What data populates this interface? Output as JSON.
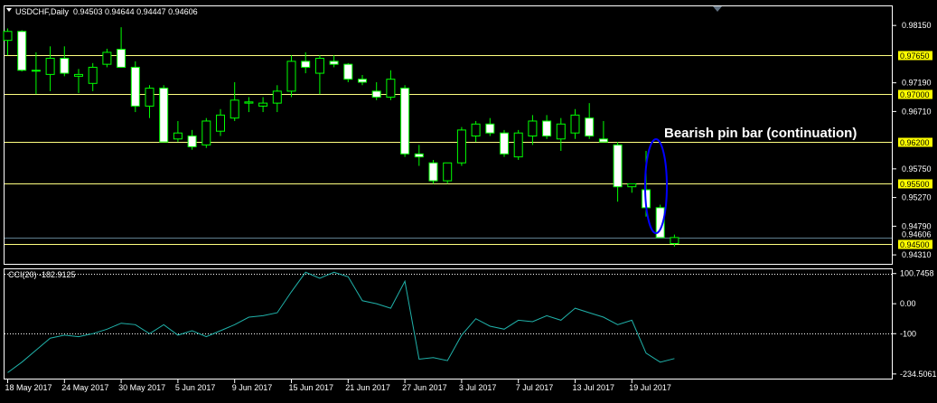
{
  "header": {
    "symbol_line": "USDCHF,Daily  0.94503 0.94644 0.94447 0.94606",
    "indicator_label": "CCI(20) -182.9125"
  },
  "annotation": {
    "text": "Bearish pin bar (continuation)"
  },
  "colors": {
    "background": "#000000",
    "bull_body": "#000000",
    "bull_edge": "#00ff00",
    "bear_body": "#ffffff",
    "wick": "#00ff00",
    "level_line": "#ffff80",
    "cci_line": "#20b2aa",
    "grid_axis": "#ffffff",
    "price_tag_bg": "#ffff00",
    "annotation_ellipse": "#0000ff"
  },
  "chart_data": [
    {
      "type": "candlestick",
      "title": "USDCHF,Daily",
      "ylim": [
        0.9416,
        0.9847
      ],
      "y_ticks": [
        "0.98150",
        "0.97190",
        "0.96710",
        "0.95750",
        "0.95270",
        "0.94790",
        "0.94310"
      ],
      "level_lines": [
        "0.97650",
        "0.97000",
        "0.96200",
        "0.95500",
        "0.94500"
      ],
      "current_price_label": "0.94606",
      "x_labels": [
        "18 May 2017",
        "24 May 2017",
        "30 May 2017",
        "5 Jun 2017",
        "9 Jun 2017",
        "15 Jun 2017",
        "21 Jun 2017",
        "27 Jun 2017",
        "3 Jul 2017",
        "7 Jul 2017",
        "13 Jul 2017",
        "19 Jul 2017"
      ],
      "x_label_index": [
        0,
        4,
        8,
        12,
        16,
        20,
        24,
        28,
        32,
        36,
        40,
        44
      ],
      "candles": [
        {
          "o": 0.979,
          "h": 0.981,
          "l": 0.9765,
          "c": 0.9805
        },
        {
          "o": 0.9805,
          "h": 0.9807,
          "l": 0.9738,
          "c": 0.974
        },
        {
          "o": 0.974,
          "h": 0.977,
          "l": 0.97,
          "c": 0.974
        },
        {
          "o": 0.9733,
          "h": 0.978,
          "l": 0.9705,
          "c": 0.976
        },
        {
          "o": 0.976,
          "h": 0.978,
          "l": 0.973,
          "c": 0.9735
        },
        {
          "o": 0.973,
          "h": 0.9742,
          "l": 0.9702,
          "c": 0.9733
        },
        {
          "o": 0.9718,
          "h": 0.9752,
          "l": 0.9705,
          "c": 0.9745
        },
        {
          "o": 0.975,
          "h": 0.9776,
          "l": 0.9745,
          "c": 0.977
        },
        {
          "o": 0.9775,
          "h": 0.9812,
          "l": 0.9745,
          "c": 0.9745
        },
        {
          "o": 0.9745,
          "h": 0.9755,
          "l": 0.967,
          "c": 0.968
        },
        {
          "o": 0.968,
          "h": 0.9715,
          "l": 0.966,
          "c": 0.971
        },
        {
          "o": 0.971,
          "h": 0.9715,
          "l": 0.962,
          "c": 0.962
        },
        {
          "o": 0.9625,
          "h": 0.9655,
          "l": 0.962,
          "c": 0.9635
        },
        {
          "o": 0.963,
          "h": 0.964,
          "l": 0.9607,
          "c": 0.9612
        },
        {
          "o": 0.9615,
          "h": 0.966,
          "l": 0.961,
          "c": 0.9655
        },
        {
          "o": 0.9638,
          "h": 0.9675,
          "l": 0.963,
          "c": 0.9665
        },
        {
          "o": 0.966,
          "h": 0.972,
          "l": 0.9655,
          "c": 0.969
        },
        {
          "o": 0.9685,
          "h": 0.9695,
          "l": 0.967,
          "c": 0.9687
        },
        {
          "o": 0.968,
          "h": 0.9695,
          "l": 0.967,
          "c": 0.9685
        },
        {
          "o": 0.9685,
          "h": 0.9715,
          "l": 0.967,
          "c": 0.9705
        },
        {
          "o": 0.9705,
          "h": 0.9765,
          "l": 0.9695,
          "c": 0.9755
        },
        {
          "o": 0.9755,
          "h": 0.977,
          "l": 0.9735,
          "c": 0.9745
        },
        {
          "o": 0.9735,
          "h": 0.9765,
          "l": 0.97,
          "c": 0.976
        },
        {
          "o": 0.9755,
          "h": 0.9765,
          "l": 0.9745,
          "c": 0.975
        },
        {
          "o": 0.975,
          "h": 0.9752,
          "l": 0.972,
          "c": 0.9725
        },
        {
          "o": 0.9725,
          "h": 0.9732,
          "l": 0.9715,
          "c": 0.972
        },
        {
          "o": 0.9705,
          "h": 0.972,
          "l": 0.969,
          "c": 0.9695
        },
        {
          "o": 0.9695,
          "h": 0.974,
          "l": 0.969,
          "c": 0.9725
        },
        {
          "o": 0.971,
          "h": 0.9715,
          "l": 0.9595,
          "c": 0.96
        },
        {
          "o": 0.96,
          "h": 0.9615,
          "l": 0.958,
          "c": 0.9595
        },
        {
          "o": 0.9585,
          "h": 0.959,
          "l": 0.955,
          "c": 0.9555
        },
        {
          "o": 0.9555,
          "h": 0.9585,
          "l": 0.955,
          "c": 0.9585
        },
        {
          "o": 0.9585,
          "h": 0.9645,
          "l": 0.958,
          "c": 0.964
        },
        {
          "o": 0.963,
          "h": 0.9655,
          "l": 0.962,
          "c": 0.965
        },
        {
          "o": 0.965,
          "h": 0.966,
          "l": 0.963,
          "c": 0.9635
        },
        {
          "o": 0.9635,
          "h": 0.964,
          "l": 0.9595,
          "c": 0.96
        },
        {
          "o": 0.9595,
          "h": 0.964,
          "l": 0.959,
          "c": 0.9635
        },
        {
          "o": 0.963,
          "h": 0.9665,
          "l": 0.9615,
          "c": 0.9655
        },
        {
          "o": 0.9655,
          "h": 0.9665,
          "l": 0.9625,
          "c": 0.963
        },
        {
          "o": 0.9625,
          "h": 0.966,
          "l": 0.9605,
          "c": 0.965
        },
        {
          "o": 0.9635,
          "h": 0.9675,
          "l": 0.9625,
          "c": 0.9665
        },
        {
          "o": 0.966,
          "h": 0.9685,
          "l": 0.9625,
          "c": 0.963
        },
        {
          "o": 0.9625,
          "h": 0.9655,
          "l": 0.962,
          "c": 0.962
        },
        {
          "o": 0.9615,
          "h": 0.962,
          "l": 0.952,
          "c": 0.9545
        },
        {
          "o": 0.9545,
          "h": 0.955,
          "l": 0.9535,
          "c": 0.955
        },
        {
          "o": 0.954,
          "h": 0.9605,
          "l": 0.9495,
          "c": 0.951
        },
        {
          "o": 0.951,
          "h": 0.9515,
          "l": 0.946,
          "c": 0.946
        },
        {
          "o": 0.945,
          "h": 0.9465,
          "l": 0.9445,
          "c": 0.946
        }
      ],
      "pin_bar_index": 45
    },
    {
      "type": "line",
      "title": "CCI(20) -182.9125",
      "ylim": [
        -250,
        115
      ],
      "y_ticks": [
        "100.7458",
        "0.00",
        "-100",
        "-234.5061"
      ],
      "y_tick_values": [
        100.7458,
        0,
        -100,
        -234.5061
      ],
      "dotted_levels": [
        100,
        -100
      ],
      "series": [
        {
          "values": [
            -230,
            -195,
            -155,
            -115,
            -105,
            -110,
            -100,
            -85,
            -65,
            -70,
            -100,
            -70,
            -105,
            -90,
            -110,
            -90,
            -70,
            -45,
            -40,
            -30,
            40,
            105,
            85,
            105,
            90,
            10,
            0,
            -15,
            75,
            -185,
            -180,
            -190,
            -105,
            -50,
            -75,
            -85,
            -55,
            -60,
            -40,
            -55,
            -15,
            -30,
            -45,
            -70,
            -55,
            -165,
            -195,
            -182.9125
          ]
        }
      ]
    }
  ]
}
